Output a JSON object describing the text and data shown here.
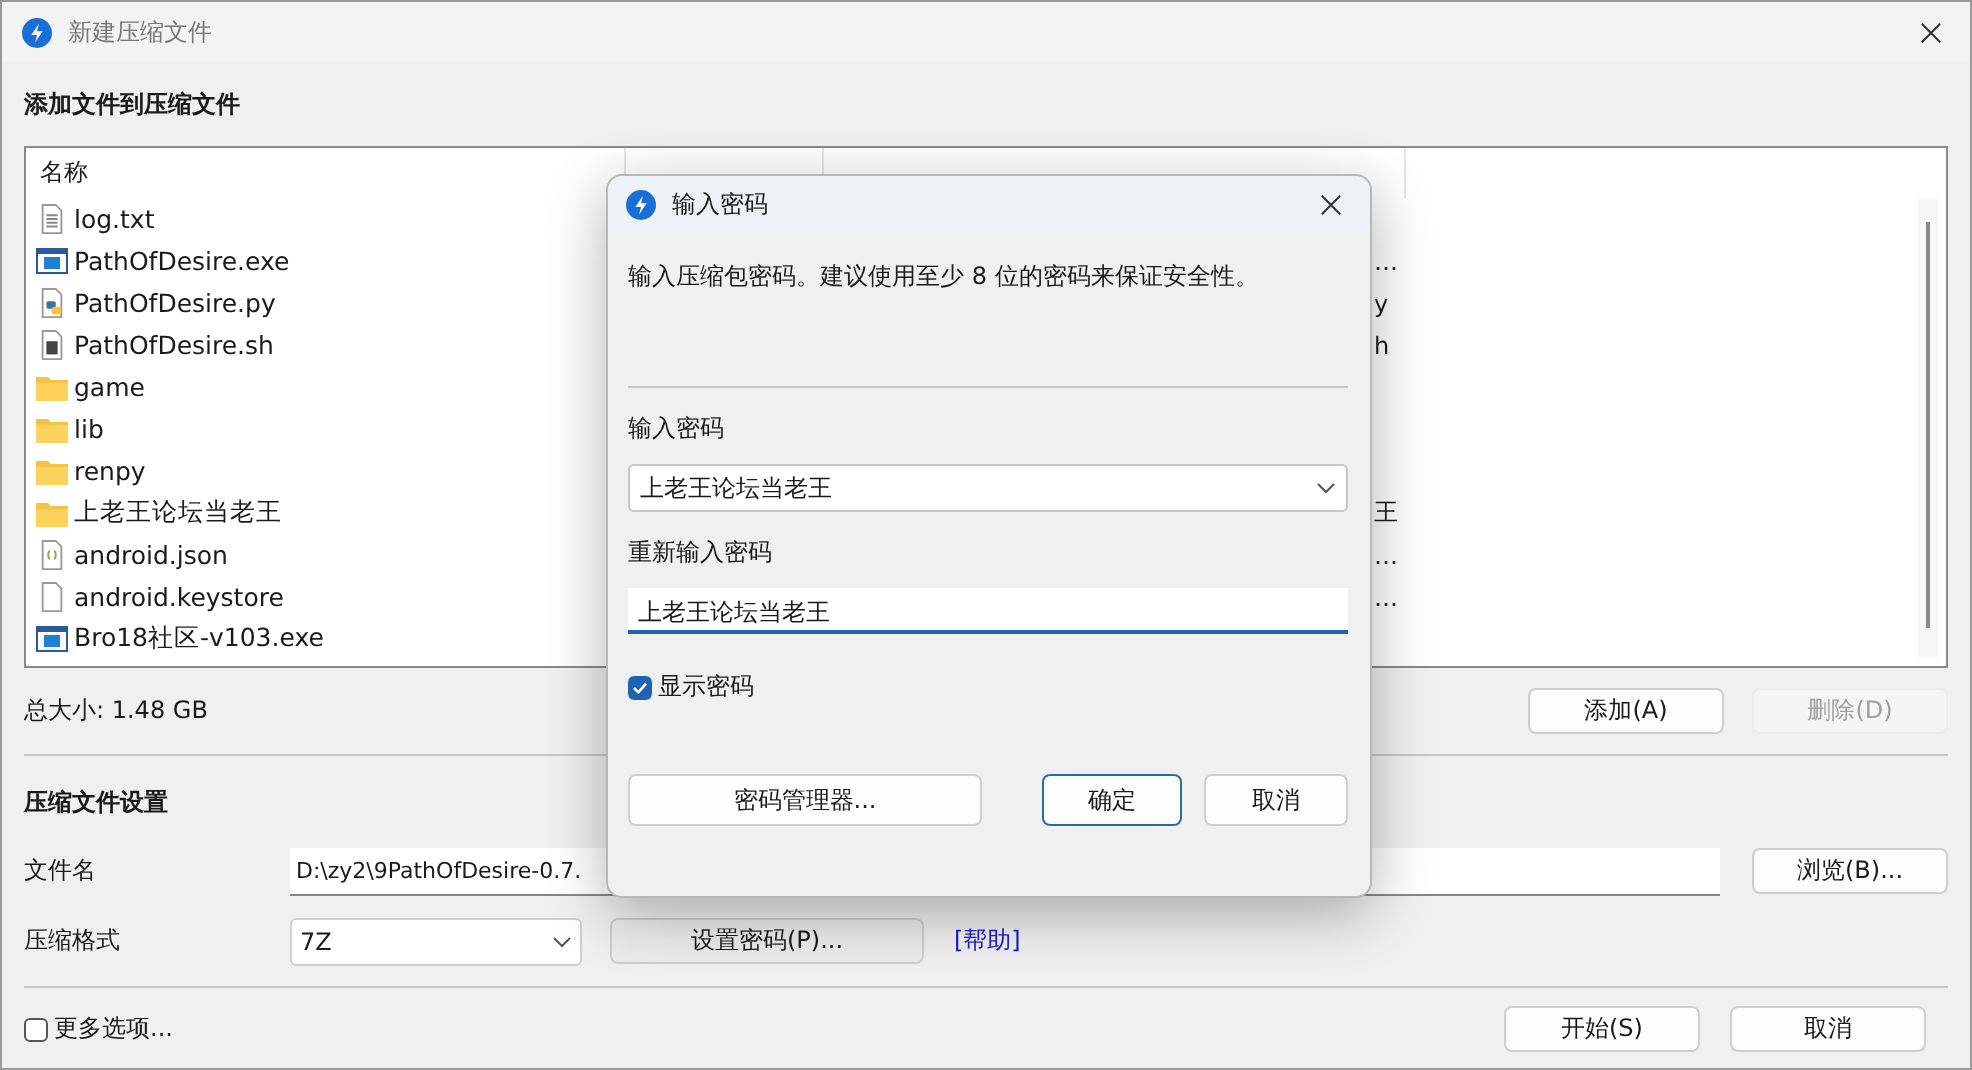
{
  "window": {
    "title": "新建压缩文件"
  },
  "files_section": {
    "heading": "添加文件到压缩文件",
    "columns": [
      "名称"
    ],
    "rows": [
      {
        "kind": "text",
        "name": "log.txt"
      },
      {
        "kind": "exe",
        "name": "PathOfDesire.exe",
        "path": "…"
      },
      {
        "kind": "python",
        "name": "PathOfDesire.py",
        "path": "y"
      },
      {
        "kind": "script",
        "name": "PathOfDesire.sh",
        "path": "h"
      },
      {
        "kind": "folder",
        "name": "game"
      },
      {
        "kind": "folder",
        "name": "lib"
      },
      {
        "kind": "folder",
        "name": "renpy"
      },
      {
        "kind": "folder",
        "name": "上老王论坛当老王",
        "path": "王"
      },
      {
        "kind": "json",
        "name": "android.json",
        "path": "…"
      },
      {
        "kind": "file",
        "name": "android.keystore",
        "path": "…"
      },
      {
        "kind": "exe",
        "name": "Bro18社区-v103.exe"
      }
    ],
    "total": "总大小: 1.48 GB",
    "add_button": {
      "label": "添加(A)",
      "disabled": false
    },
    "remove_button": {
      "label": "删除(D)",
      "disabled": true
    }
  },
  "settings_section": {
    "heading": "压缩文件设置",
    "filename_label": "文件名",
    "filename_value": "D:\\zy2\\9PathOfDesire-0.7.",
    "browse_button": "浏览(B)...",
    "format_label": "压缩格式",
    "format_value": "7Z",
    "password_button": "设置密码(P)...",
    "help_link": "[帮助]"
  },
  "more_options": {
    "label": "更多选项...",
    "checked": false
  },
  "buttons": [
    "开始(S)",
    "取消"
  ],
  "password_dialog": {
    "title": "输入密码",
    "description": "输入压缩包密码。建议使用至少 8 位的密码来保证安全性。",
    "password_label": "输入密码",
    "password_value": "上老王论坛当老王",
    "confirm_label": "重新输入密码",
    "confirm_value": "上老王论坛当老王",
    "show_password": {
      "label": "显示密码",
      "checked": true
    },
    "manager_button": "密码管理器...",
    "ok_button": "确定",
    "cancel_button": "取消"
  }
}
